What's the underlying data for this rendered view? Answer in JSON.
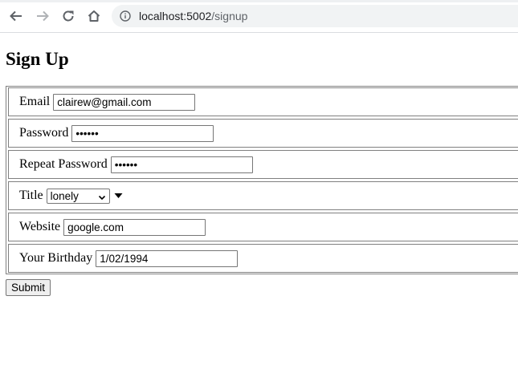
{
  "browser": {
    "url_host": "localhost:5002",
    "url_path": "/signup",
    "icons": [
      "back-icon",
      "forward-icon",
      "reload-icon",
      "home-icon",
      "info-icon"
    ]
  },
  "page": {
    "title": "Sign Up",
    "fields": {
      "email": {
        "label": "Email",
        "value": "clairew@gmail.com"
      },
      "password": {
        "label": "Password",
        "value": "••••••"
      },
      "repeat_password": {
        "label": "Repeat Password",
        "value": "••••••"
      },
      "title": {
        "label": "Title",
        "selected": "lonely"
      },
      "website": {
        "label": "Website",
        "value": "google.com"
      },
      "birthday": {
        "label": "Your Birthday",
        "value": "1/02/1994"
      }
    },
    "submit_label": "Submit"
  }
}
